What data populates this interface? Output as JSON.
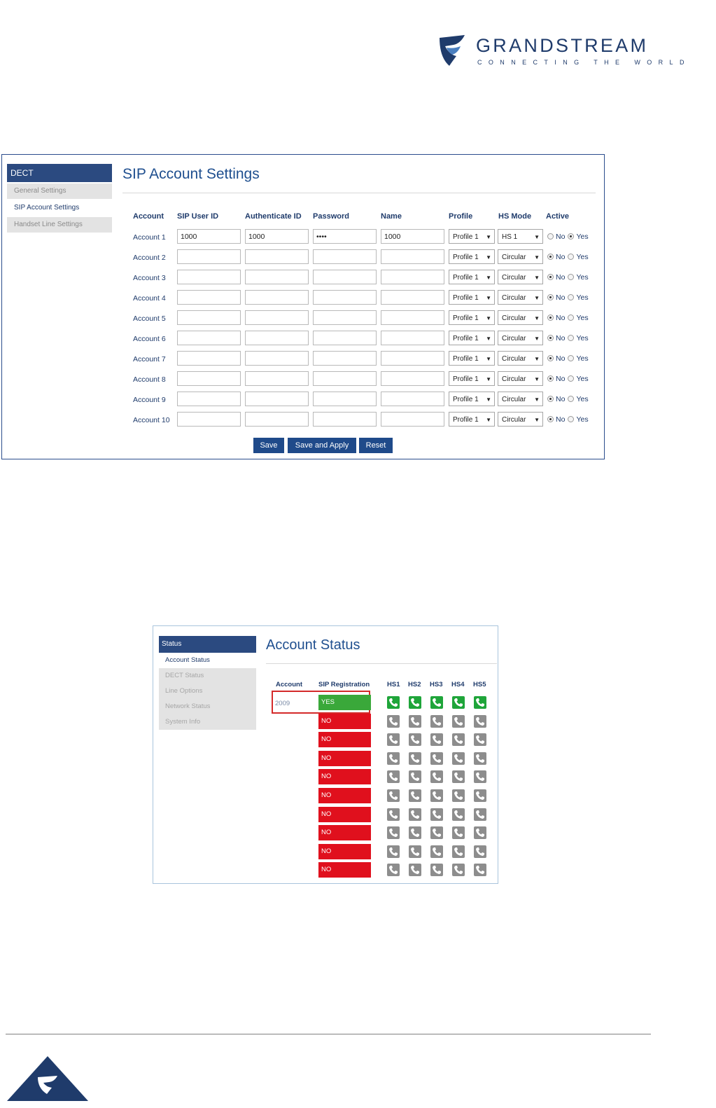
{
  "brand": {
    "name": "GRANDSTREAM",
    "tagline": "CONNECTING THE WORLD",
    "colors": {
      "brand_blue": "#1f3b6b",
      "nav_blue": "#2b4a80",
      "yes_green": "#3aa83a",
      "no_red": "#e0101d"
    }
  },
  "sip_settings": {
    "sidebar": {
      "header": "DECT",
      "items": [
        {
          "label": "General Settings",
          "active": false
        },
        {
          "label": "SIP Account Settings",
          "active": true
        },
        {
          "label": "Handset Line Settings",
          "active": false
        }
      ]
    },
    "title": "SIP Account Settings",
    "columns": [
      "Account",
      "SIP User ID",
      "Authenticate ID",
      "Password",
      "Name",
      "Profile",
      "HS Mode",
      "Active"
    ],
    "radio_labels": {
      "no": "No",
      "yes": "Yes"
    },
    "rows": [
      {
        "account": "Account 1",
        "sip_user_id": "1000",
        "auth_id": "1000",
        "password": "••••",
        "name": "1000",
        "profile": "Profile 1",
        "hs_mode": "HS 1",
        "active": "Yes"
      },
      {
        "account": "Account 2",
        "sip_user_id": "",
        "auth_id": "",
        "password": "",
        "name": "",
        "profile": "Profile 1",
        "hs_mode": "Circular",
        "active": "No"
      },
      {
        "account": "Account 3",
        "sip_user_id": "",
        "auth_id": "",
        "password": "",
        "name": "",
        "profile": "Profile 1",
        "hs_mode": "Circular",
        "active": "No"
      },
      {
        "account": "Account 4",
        "sip_user_id": "",
        "auth_id": "",
        "password": "",
        "name": "",
        "profile": "Profile 1",
        "hs_mode": "Circular",
        "active": "No"
      },
      {
        "account": "Account 5",
        "sip_user_id": "",
        "auth_id": "",
        "password": "",
        "name": "",
        "profile": "Profile 1",
        "hs_mode": "Circular",
        "active": "No"
      },
      {
        "account": "Account 6",
        "sip_user_id": "",
        "auth_id": "",
        "password": "",
        "name": "",
        "profile": "Profile 1",
        "hs_mode": "Circular",
        "active": "No"
      },
      {
        "account": "Account 7",
        "sip_user_id": "",
        "auth_id": "",
        "password": "",
        "name": "",
        "profile": "Profile 1",
        "hs_mode": "Circular",
        "active": "No"
      },
      {
        "account": "Account 8",
        "sip_user_id": "",
        "auth_id": "",
        "password": "",
        "name": "",
        "profile": "Profile 1",
        "hs_mode": "Circular",
        "active": "No"
      },
      {
        "account": "Account 9",
        "sip_user_id": "",
        "auth_id": "",
        "password": "",
        "name": "",
        "profile": "Profile 1",
        "hs_mode": "Circular",
        "active": "No"
      },
      {
        "account": "Account 10",
        "sip_user_id": "",
        "auth_id": "",
        "password": "",
        "name": "",
        "profile": "Profile 1",
        "hs_mode": "Circular",
        "active": "No"
      }
    ],
    "buttons": {
      "save": "Save",
      "save_apply": "Save and Apply",
      "reset": "Reset"
    }
  },
  "account_status": {
    "sidebar": {
      "header": "Status",
      "items": [
        {
          "label": "Account Status",
          "active": true
        },
        {
          "label": "DECT Status",
          "active": false
        },
        {
          "label": "Line Options",
          "active": false
        },
        {
          "label": "Network Status",
          "active": false
        },
        {
          "label": "System Info",
          "active": false
        }
      ]
    },
    "title": "Account Status",
    "columns": [
      "Account",
      "SIP Registration",
      "HS1",
      "HS2",
      "HS3",
      "HS4",
      "HS5"
    ],
    "rows": [
      {
        "account": "2009",
        "registration": "YES",
        "hs_active": [
          true,
          true,
          true,
          true,
          true
        ]
      },
      {
        "account": "",
        "registration": "NO",
        "hs_active": [
          false,
          false,
          false,
          false,
          false
        ]
      },
      {
        "account": "",
        "registration": "NO",
        "hs_active": [
          false,
          false,
          false,
          false,
          false
        ]
      },
      {
        "account": "",
        "registration": "NO",
        "hs_active": [
          false,
          false,
          false,
          false,
          false
        ]
      },
      {
        "account": "",
        "registration": "NO",
        "hs_active": [
          false,
          false,
          false,
          false,
          false
        ]
      },
      {
        "account": "",
        "registration": "NO",
        "hs_active": [
          false,
          false,
          false,
          false,
          false
        ]
      },
      {
        "account": "",
        "registration": "NO",
        "hs_active": [
          false,
          false,
          false,
          false,
          false
        ]
      },
      {
        "account": "",
        "registration": "NO",
        "hs_active": [
          false,
          false,
          false,
          false,
          false
        ]
      },
      {
        "account": "",
        "registration": "NO",
        "hs_active": [
          false,
          false,
          false,
          false,
          false
        ]
      },
      {
        "account": "",
        "registration": "NO",
        "hs_active": [
          false,
          false,
          false,
          false,
          false
        ]
      }
    ]
  }
}
